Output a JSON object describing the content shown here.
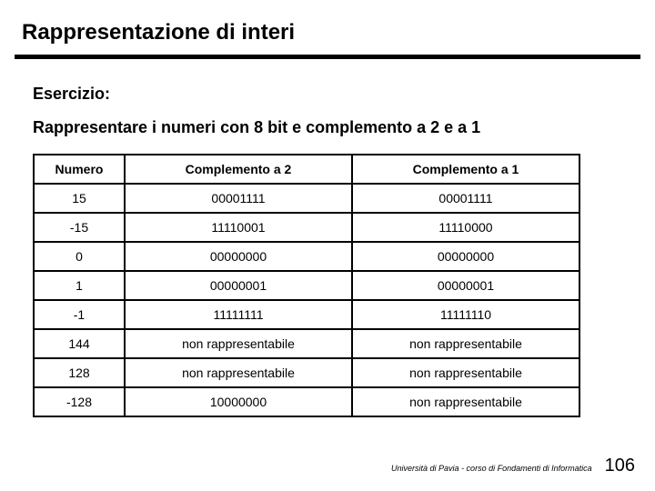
{
  "title": "Rappresentazione di interi",
  "exercise_label": "Esercizio:",
  "exercise_text": "Rappresentare i numeri con 8 bit e complemento a 2 e a 1",
  "table": {
    "headers": [
      "Numero",
      "Complemento a 2",
      "Complemento a 1"
    ],
    "rows": [
      [
        "15",
        "00001111",
        "00001111"
      ],
      [
        "-15",
        "11110001",
        "11110000"
      ],
      [
        "0",
        "00000000",
        "00000000"
      ],
      [
        "1",
        "00000001",
        "00000001"
      ],
      [
        "-1",
        "11111111",
        "11111110"
      ],
      [
        "144",
        "non rappresentabile",
        "non rappresentabile"
      ],
      [
        "128",
        "non rappresentabile",
        "non rappresentabile"
      ],
      [
        "-128",
        "10000000",
        "non rappresentabile"
      ]
    ]
  },
  "footer": {
    "course": "Università di Pavia - corso di Fondamenti di Informatica",
    "page": "106"
  }
}
